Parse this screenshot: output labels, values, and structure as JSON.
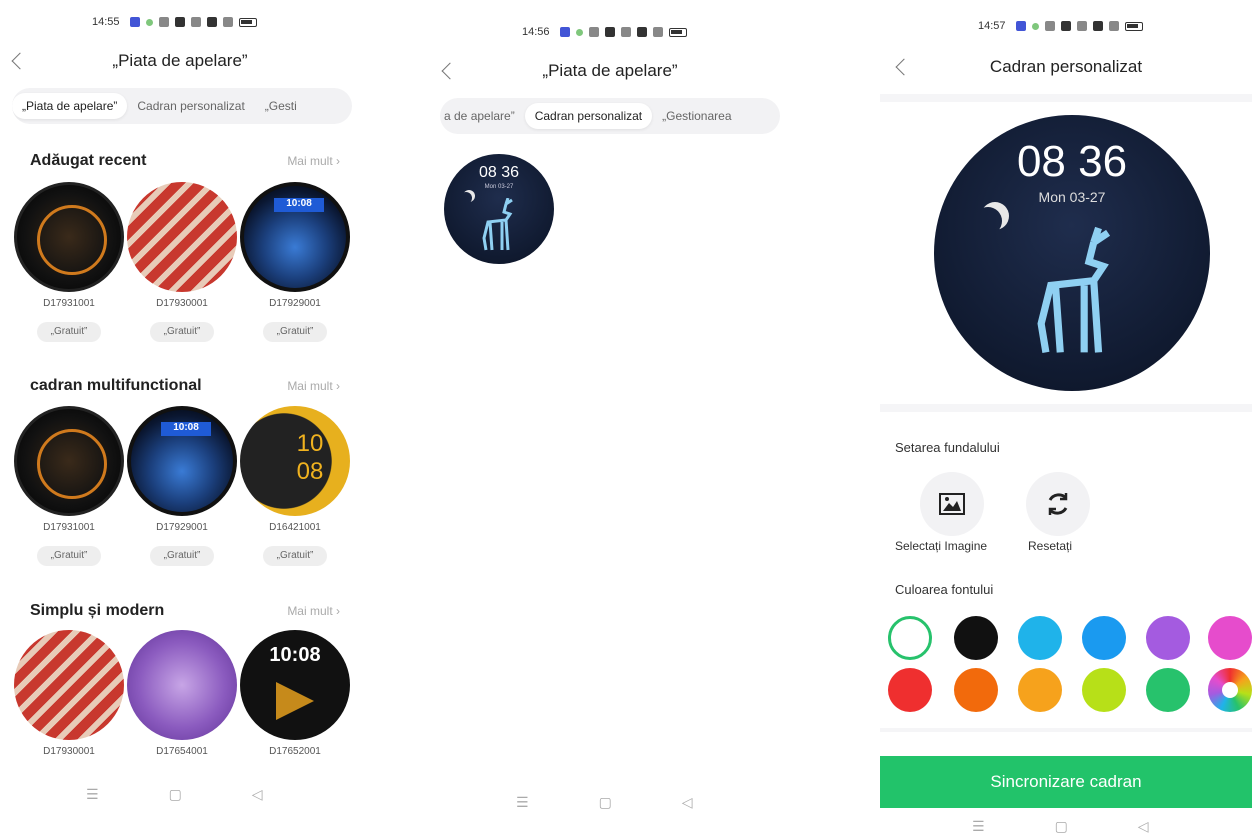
{
  "screen1": {
    "status_time": "14:55",
    "title": "„Piata de apelare”",
    "tabs": [
      "„Piata de apelare”",
      "Cadran personalizat",
      "„Gesti"
    ],
    "sections": [
      {
        "title": "Adăugat recent",
        "more": "Mai mult",
        "faces": [
          {
            "id": "D17931001",
            "badge": "„Gratuit”",
            "style": "dark"
          },
          {
            "id": "D17930001",
            "badge": "„Gratuit”",
            "style": "stripe"
          },
          {
            "id": "D17929001",
            "badge": "„Gratuit”",
            "style": "earth",
            "face_text": "10:08"
          }
        ]
      },
      {
        "title": "cadran multifunctional",
        "more": "Mai mult",
        "faces": [
          {
            "id": "D17931001",
            "badge": "„Gratuit”",
            "style": "dark"
          },
          {
            "id": "D17929001",
            "badge": "„Gratuit”",
            "style": "earth",
            "face_text": "10:08"
          },
          {
            "id": "D16421001",
            "badge": "„Gratuit”",
            "style": "gold",
            "face_text": "10 08"
          }
        ]
      },
      {
        "title": "Simplu și modern",
        "more": "Mai mult",
        "faces": [
          {
            "id": "D17930001",
            "style": "stripe"
          },
          {
            "id": "D17654001",
            "style": "purple"
          },
          {
            "id": "D17652001",
            "style": "black",
            "face_text": "10:08"
          }
        ]
      }
    ]
  },
  "screen2": {
    "status_time": "14:56",
    "title": "„Piata de apelare”",
    "tabs": [
      "a de apelare”",
      "Cadran personalizat",
      "„Gestionarea"
    ],
    "face_time": "08 36",
    "face_date": "Mon 03-27"
  },
  "screen3": {
    "status_time": "14:57",
    "title": "Cadran personalizat",
    "face_time": "08 36",
    "face_date": "Mon  03-27",
    "background_label": "Setarea fundalului",
    "select_image": "Selectați Imagine",
    "reset": "Resetați",
    "font_color_label": "Culoarea fontului",
    "colors_row1": [
      "#ffffff",
      "#111111",
      "#1fb3ea",
      "#1a9af0",
      "#a45be0",
      "#e64ccc"
    ],
    "colors_row2": [
      "#ef2f2f",
      "#f26a0c",
      "#f6a21c",
      "#b7e018",
      "#27c26c",
      "multicolor"
    ],
    "sync_button": "Sincronizare cadran"
  },
  "nav": {
    "menu": "☰",
    "home": "▢",
    "back": "◁"
  }
}
